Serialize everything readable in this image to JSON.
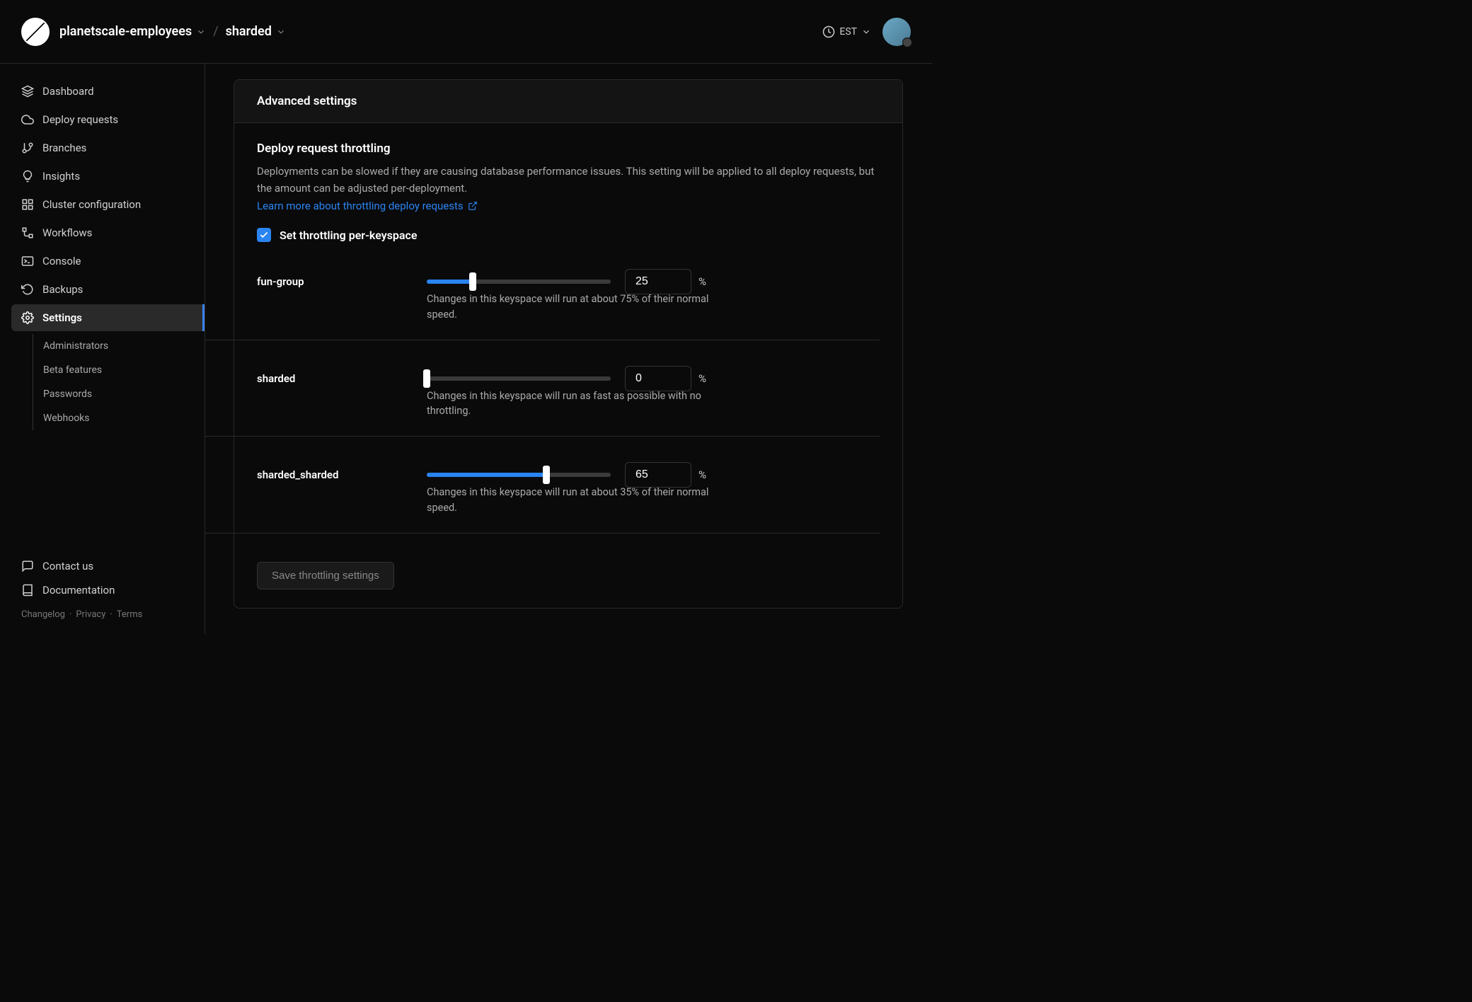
{
  "header": {
    "org": "planetscale-employees",
    "db": "sharded",
    "tz": "EST"
  },
  "sidebar": {
    "items": [
      {
        "label": "Dashboard"
      },
      {
        "label": "Deploy requests"
      },
      {
        "label": "Branches"
      },
      {
        "label": "Insights"
      },
      {
        "label": "Cluster configuration"
      },
      {
        "label": "Workflows"
      },
      {
        "label": "Console"
      },
      {
        "label": "Backups"
      },
      {
        "label": "Settings"
      }
    ],
    "sub": [
      {
        "label": "Administrators"
      },
      {
        "label": "Beta features"
      },
      {
        "label": "Passwords"
      },
      {
        "label": "Webhooks"
      }
    ],
    "footer": {
      "contact": "Contact us",
      "docs": "Documentation",
      "changelog": "Changelog",
      "privacy": "Privacy",
      "terms": "Terms"
    }
  },
  "card": {
    "title": "Advanced settings",
    "section_title": "Deploy request throttling",
    "section_desc": "Deployments can be slowed if they are causing database performance issues. This setting will be applied to all deploy requests, but the amount can be adjusted per-deployment.",
    "learn_more": "Learn more about throttling deploy requests",
    "checkbox_label": "Set throttling per-keyspace",
    "checkbox_checked": true,
    "keyspaces": [
      {
        "name": "fun-group",
        "value": "25",
        "hint": "Changes in this keyspace will run at about 75% of their normal speed."
      },
      {
        "name": "sharded",
        "value": "0",
        "hint": "Changes in this keyspace will run as fast as possible with no throttling."
      },
      {
        "name": "sharded_sharded",
        "value": "65",
        "hint": "Changes in this keyspace will run at about 35% of their normal speed."
      }
    ],
    "percent": "%",
    "save": "Save throttling settings"
  }
}
